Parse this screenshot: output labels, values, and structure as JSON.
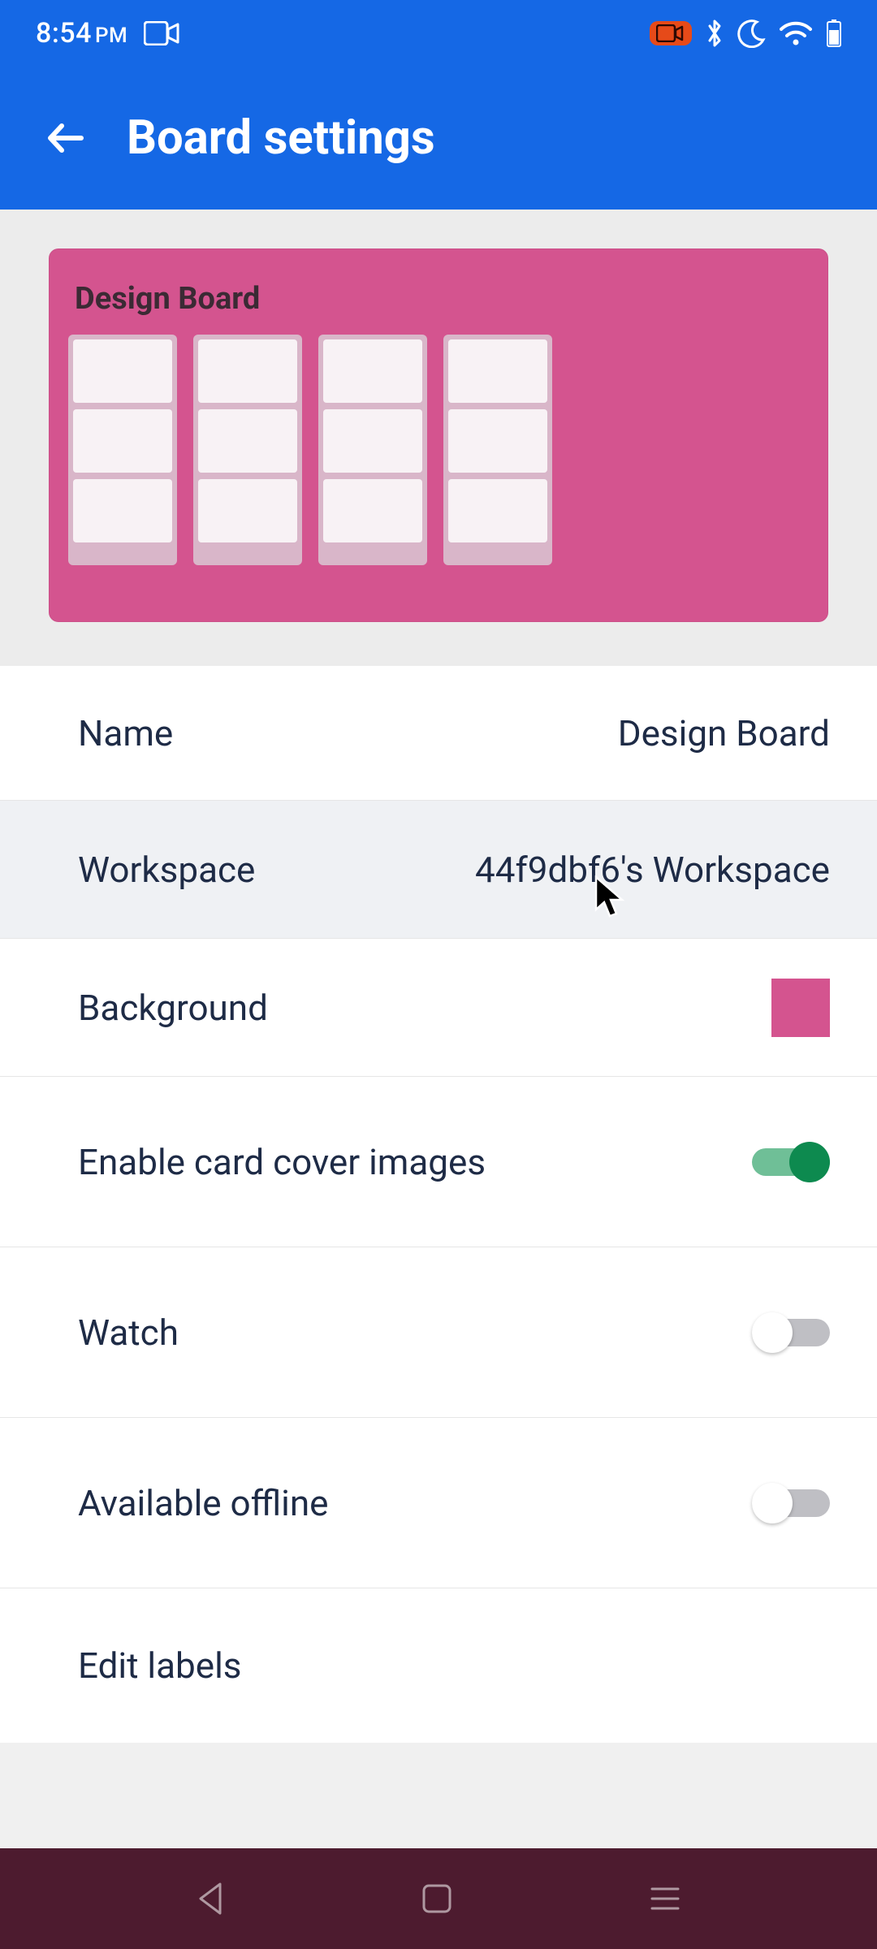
{
  "status": {
    "time": "8:54",
    "ampm": "PM"
  },
  "appbar": {
    "title": "Board settings"
  },
  "preview": {
    "board_name": "Design Board"
  },
  "rows": {
    "name": {
      "label": "Name",
      "value": "Design Board"
    },
    "workspace": {
      "label": "Workspace",
      "value": "44f9dbf6's Workspace"
    },
    "background": {
      "label": "Background",
      "swatch_color": "#d4548f"
    },
    "cover": {
      "label": "Enable card cover images",
      "on": true
    },
    "watch": {
      "label": "Watch",
      "on": false
    },
    "offline": {
      "label": "Available offline",
      "on": false
    },
    "edit_labels": {
      "label": "Edit labels"
    }
  },
  "colors": {
    "accent": "#1568e5",
    "board_bg": "#d4548f"
  }
}
